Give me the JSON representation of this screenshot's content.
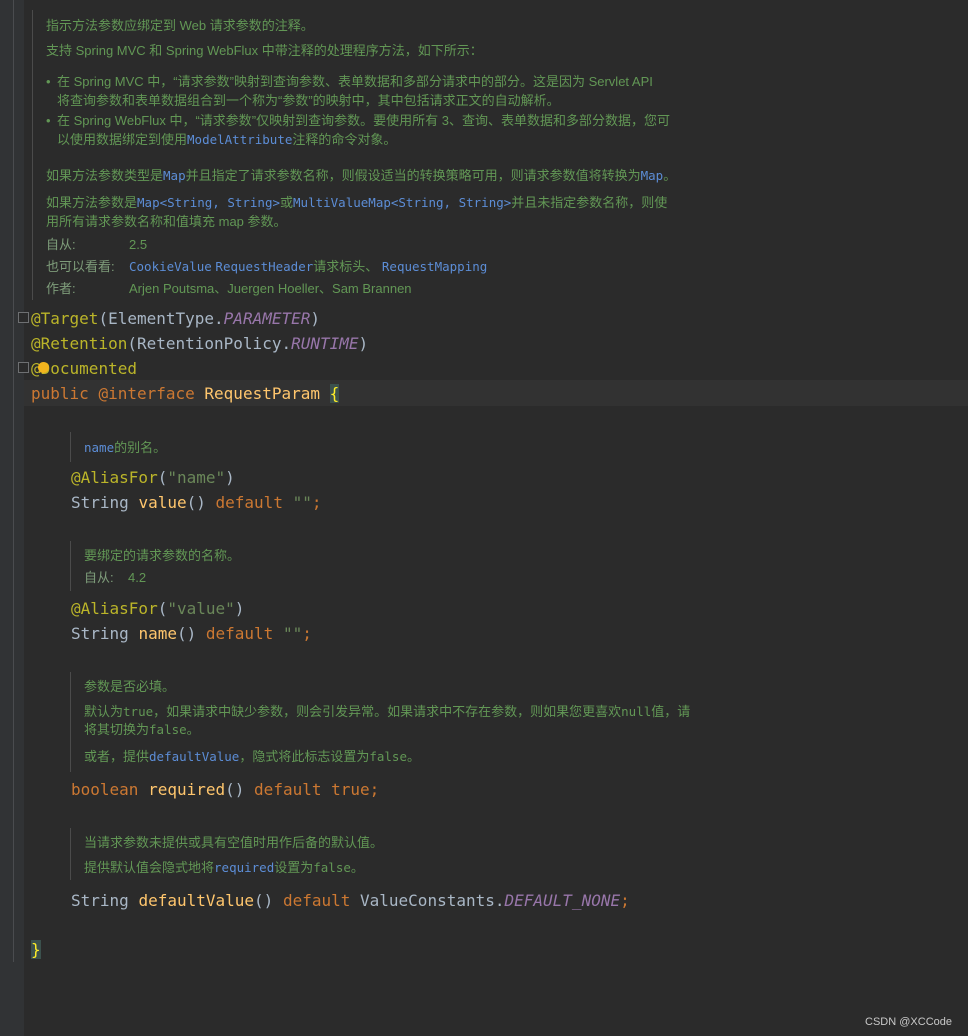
{
  "javadoc_class": {
    "line1": "指示方法参数应绑定到 Web 请求参数的注释。",
    "line2": "支持 Spring MVC 和 Spring WebFlux 中带注释的处理程序方法，如下所示：",
    "bullet1_a": "在 Spring MVC 中，“请求参数”映射到查询参数、表单数据和多部分请求中的部分。这是因为 Servlet API",
    "bullet1_b": "将查询参数和表单数据组合到一个称为“参数”的映射中，其中包括请求正文的自动解析。",
    "bullet2_a": "在 Spring WebFlux 中，“请求参数”仅映射到查询参数。要使用所有 3、查询、表单数据和多部分数据，您可",
    "bullet2_b_pre": "以使用数据绑定到使用",
    "bullet2_b_ref": "ModelAttribute",
    "bullet2_b_post": "注释的命令对象。",
    "map_pre": "如果方法参数类型是",
    "map_ref1": "Map",
    "map_mid": "并且指定了请求参数名称，则假设适当的转换策略可用，则请求参数值将转换为",
    "map_ref2": "Map",
    "map_end": "。",
    "mv_pre": "如果方法参数是",
    "mv_ref1": "Map<String, String>",
    "mv_mid": "或",
    "mv_ref2": "MultiValueMap<String, String>",
    "mv_post": "并且未指定参数名称，则使",
    "mv_line2": "用所有请求参数名称和值填充 map 参数。",
    "since_label": "自从:",
    "since_value": "2.5",
    "see_label": "也可以看看:",
    "see_ref1": "CookieValue",
    "see_ref2": "RequestHeader",
    "see_mid": "请求标头、",
    "see_ref3": "RequestMapping",
    "author_label": "作者:",
    "author_value": "Arjen Poutsma、Juergen Hoeller、Sam Brannen"
  },
  "code": {
    "target_ann": "@Target",
    "target_open": "(ElementType.",
    "target_const": "PARAMETER",
    "target_close": ")",
    "retention_ann": "@Retention",
    "retention_open": "(RetentionPolicy.",
    "retention_const": "RUNTIME",
    "retention_close": ")",
    "documented_at": "@",
    "documented_rest": "Documented",
    "kw_public": "public",
    "kw_interface": "@interface",
    "class_name": "RequestParam",
    "open_brace": "{",
    "close_brace": "}",
    "alias1_ann": "@AliasFor",
    "alias1_arg_open": "(",
    "alias1_arg": "\"name\"",
    "alias1_arg_close": ")",
    "value_type": "String ",
    "value_name": "value",
    "value_parens": "() ",
    "kw_default": "default",
    "value_default": " \"\"",
    "semicolon": ";",
    "alias2_ann": "@AliasFor",
    "alias2_arg": "\"value\"",
    "name_type": "String ",
    "name_name": "name",
    "name_parens": "() ",
    "name_default": " \"\"",
    "req_type": "boolean",
    "req_name": "required",
    "req_parens": "() ",
    "req_default": "true",
    "dv_type": "String ",
    "dv_name": "defaultValue",
    "dv_parens": "() ",
    "dv_class": " ValueConstants.",
    "dv_const": "DEFAULT_NONE",
    "dv_semicolon": ";"
  },
  "doc_value": {
    "ref": "name",
    "text": "的别名。"
  },
  "doc_name": {
    "line1": "要绑定的请求参数的名称。",
    "since_label": "自从:",
    "since_value": "4.2"
  },
  "doc_required": {
    "line1": "参数是否必填。",
    "l2_pre": "默认为",
    "l2_m1": "true",
    "l2_mid": "，如果请求中缺少参数，则会引发异常。如果请求中不存在参数，则如果您更喜欢",
    "l2_m2": "null",
    "l2_post": "值，请",
    "l3_pre": "将其切换为",
    "l3_m": "false",
    "l3_post": "。",
    "l4_pre": "或者，提供",
    "l4_ref": "defaultValue",
    "l4_mid": "，隐式将此标志设置为",
    "l4_m": "false",
    "l4_post": "。"
  },
  "doc_default": {
    "line1": "当请求参数未提供或具有空值时用作后备的默认值。",
    "l2_pre": "提供默认值会隐式地将",
    "l2_ref": "required",
    "l2_mid": "设置为",
    "l2_m": "false",
    "l2_post": "。"
  },
  "watermark": "CSDN @XCCode"
}
